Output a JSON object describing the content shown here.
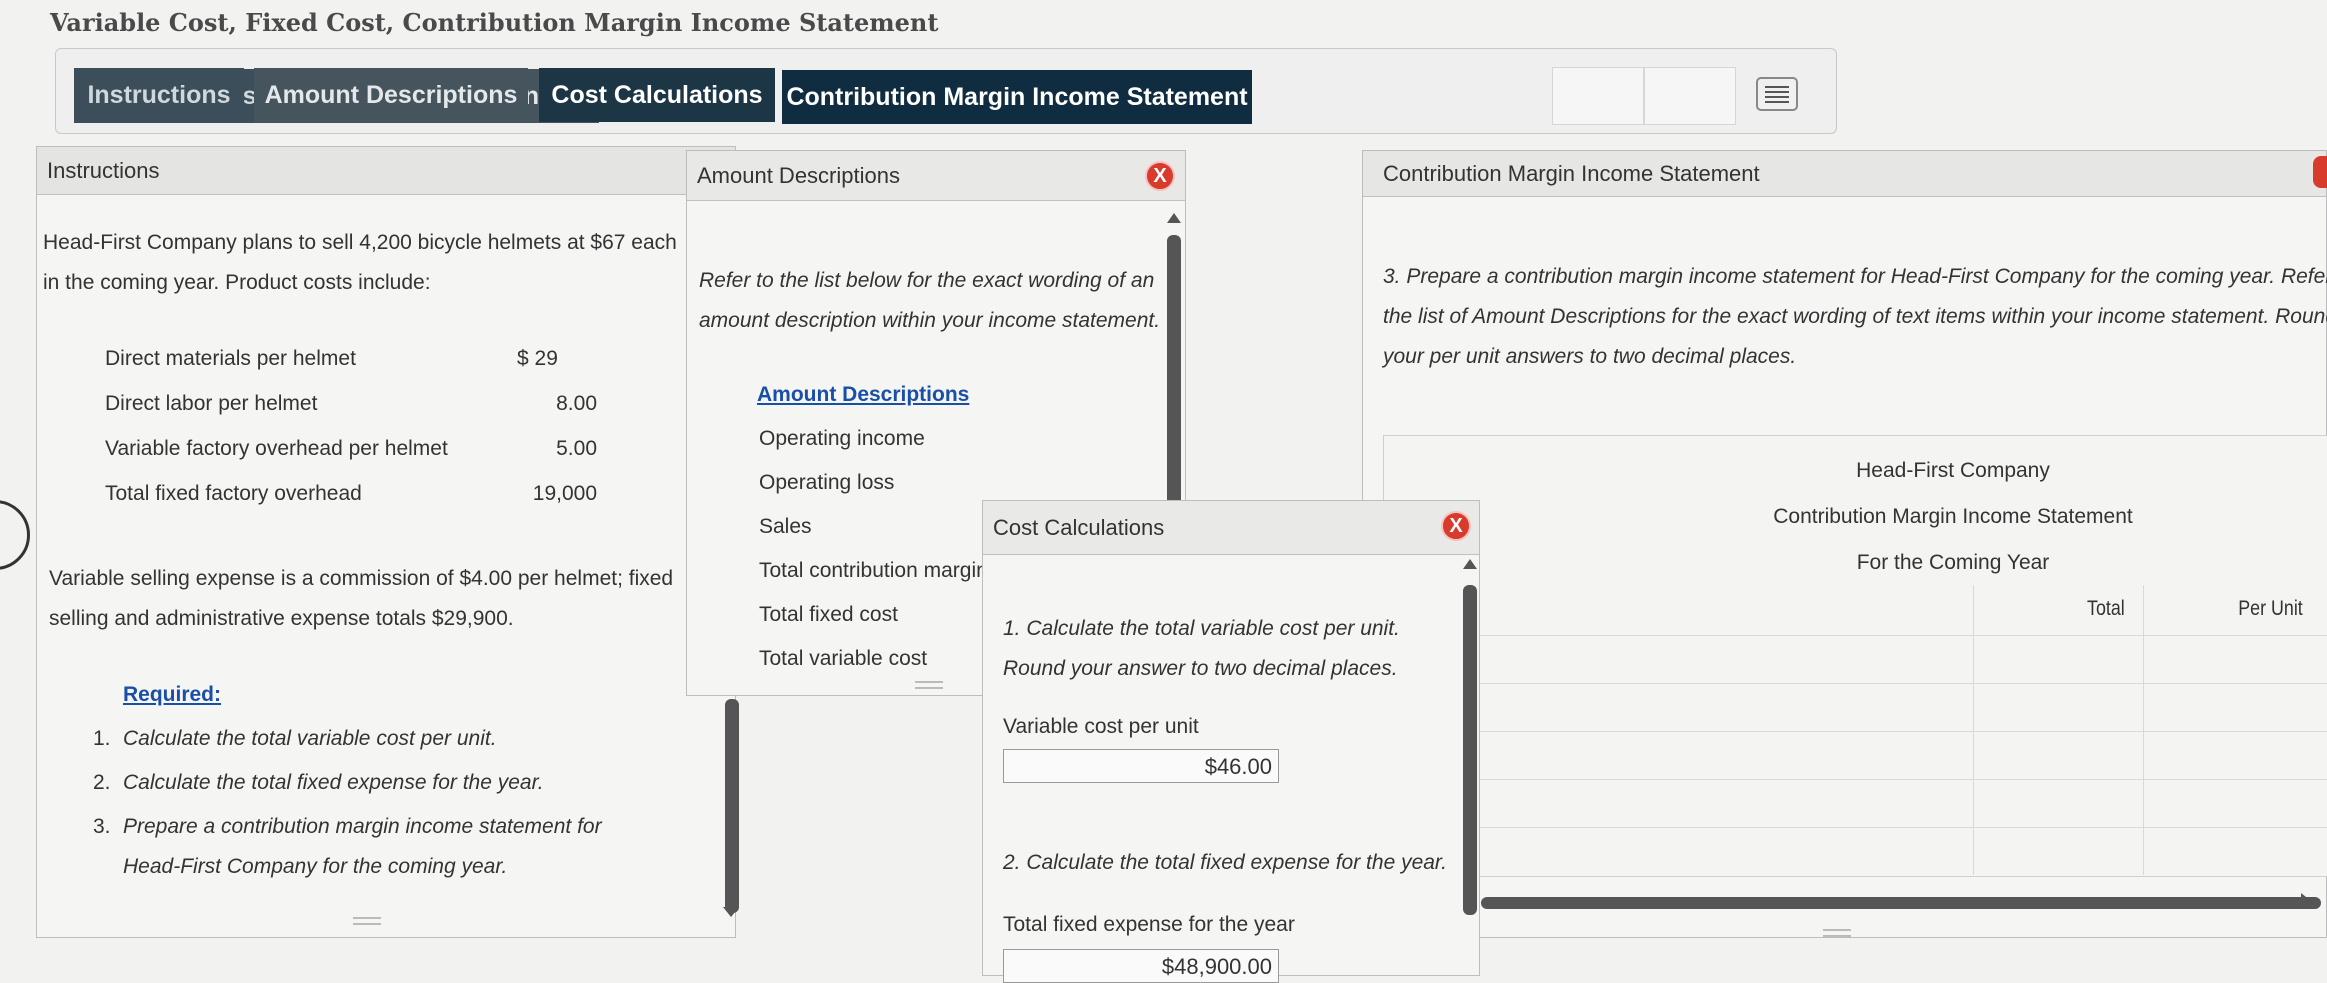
{
  "page_title": "Variable Cost, Fixed Cost, Contribution Margin Income Statement",
  "tabs": [
    {
      "label": "Instructions"
    },
    {
      "label": "Amount Descriptions"
    },
    {
      "label": "Cost Calculations"
    },
    {
      "label": "Contribution Margin Income Statement"
    }
  ],
  "instructions": {
    "header": "Instructions",
    "intro_line1": "Head-First Company plans to sell 4,200 bicycle helmets at $67 each",
    "intro_line2": "in the coming year. Product costs include:",
    "costs": [
      {
        "label": "Direct materials per helmet",
        "value": "$ 29"
      },
      {
        "label": "Direct labor per helmet",
        "value": "8.00"
      },
      {
        "label": "Variable factory overhead per helmet",
        "value": "5.00"
      },
      {
        "label": "Total fixed factory overhead",
        "value": "19,000"
      }
    ],
    "selling_line1": "Variable selling expense is a commission of $4.00 per helmet; fixed",
    "selling_line2": "selling and administrative expense totals $29,900.",
    "required_label": "Required:",
    "required": [
      {
        "num": "1.",
        "text": "Calculate the total variable cost per unit."
      },
      {
        "num": "2.",
        "text": "Calculate the total fixed expense for the year."
      },
      {
        "num": "3.",
        "text": "Prepare a contribution margin income statement for"
      }
    ],
    "required_3_cont": "Head-First Company for the coming year."
  },
  "amount_descriptions": {
    "header": "Amount Descriptions",
    "close_label": "X",
    "intro_line1": "Refer to the list below for the exact wording of an",
    "intro_line2": "amount description within your income statement.",
    "list_title": "Amount Descriptions",
    "items": [
      "Operating income",
      "Operating loss",
      "Sales",
      "Total contribution margin",
      "Total fixed cost",
      "Total variable cost"
    ]
  },
  "cost_calculations": {
    "header": "Cost Calculations",
    "close_label": "X",
    "q1_line1": "1. Calculate the total variable cost per unit.",
    "q1_line2": "Round your answer to two decimal places.",
    "var_cost_label": "Variable cost per unit",
    "var_cost_value": "$46.00",
    "q2": "2. Calculate the total fixed expense for the year.",
    "fixed_label": "Total fixed expense for the year",
    "fixed_value": "$48,900.00"
  },
  "cm_statement": {
    "header": "Contribution Margin Income Statement",
    "instr_line1": "3. Prepare a contribution margin income statement for Head-First Company for the coming year. Refer to",
    "instr_line2": "the list of Amount Descriptions for the exact wording of text items within your income statement. Round",
    "instr_line3": "your per unit answers to two decimal places.",
    "company": "Head-First Company",
    "statement_title": "Contribution Margin Income Statement",
    "period": "For the Coming Year",
    "col_total": "Total",
    "col_per_unit": "Per Unit"
  },
  "colors": {
    "tab_dark": "#0f2c40",
    "close_red": "#d83a2c",
    "link_blue": "#1a4fa8"
  }
}
